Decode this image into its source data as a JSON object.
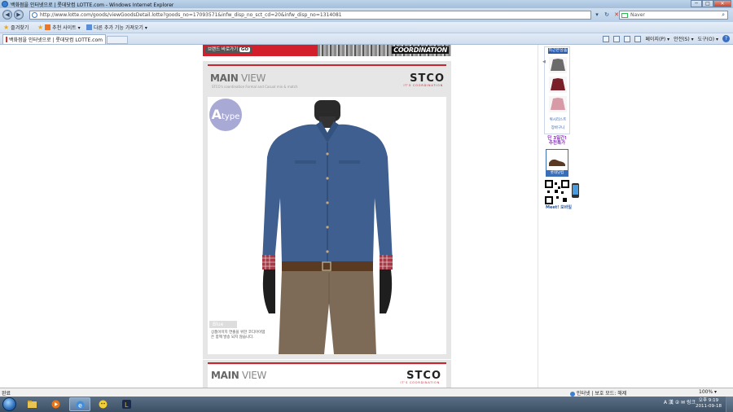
{
  "window": {
    "title": "백화점을 인터넷으로 | 롯데닷컴 LOTTE.com - Windows Internet Explorer",
    "minimize": "─",
    "maximize": "□",
    "close": "✕"
  },
  "address_bar": {
    "url": "http://www.lotte.com/goods/viewGoodsDetail.lotte?goods_no=17093571&infw_disp_no_sct_cd=20&infw_disp_no=1314081",
    "refresh_icon": "refresh-icon",
    "stop_icon": "stop-icon"
  },
  "search": {
    "provider": "Naver",
    "placeholder": "Naver"
  },
  "favorites_bar": {
    "favorites_label": "즐겨찾기",
    "suggested_sites": "추천 사이트 ▾",
    "more_addons": "다른 추가 기능 가져오기 ▾"
  },
  "tab": {
    "label": "백화점을 인터넷으로 | 롯데닷컴 LOTTE.com"
  },
  "command_bar": {
    "page": "페이지(P) ▾",
    "safety": "안전(S) ▾",
    "tools": "도구(O) ▾",
    "help": "?"
  },
  "banner": {
    "go_button": "브랜드 바로가기",
    "go": "GO",
    "logo_text": "COORDINATION"
  },
  "product_card": {
    "main_view": "MAIN",
    "main_view_light": " VIEW",
    "subtitle": "STCO's coordination Formal and Casual mix & match",
    "brand": "STCO",
    "brand_tagline": "IT'S COORDINATION",
    "type_badge_letter": "A",
    "type_badge_word": "type",
    "color_tag": "Blue",
    "caption": "상품이미지 연출을 위한 코디아이템은 함께 발송 되지 않습니다."
  },
  "product_card_2": {
    "main_view": "MAIN",
    "main_view_light": " VIEW",
    "brand": "STCO",
    "brand_tagline": "IT'S COORDINATION"
  },
  "quick_panel": {
    "header": "최근본상품",
    "items": [
      {
        "label": ""
      },
      {
        "label": ""
      },
      {
        "label": "위시리스트"
      },
      {
        "label": "장바구니"
      }
    ],
    "promo_line1": "단 3일간!",
    "promo_line2": "추천특가",
    "shoe_label": "롯데닷컴",
    "meet_label": "Meet! 모바일"
  },
  "status_bar": {
    "done": "완료",
    "zone": "인터넷 | 보호 모드: 해제",
    "zoom": "100% ▾"
  },
  "taskbar": {
    "tray_text": "A 漢 ② ✉  링크",
    "time": "오후 9:19",
    "date": "2011-09-18"
  },
  "colors": {
    "lotte_red": "#d21f2b",
    "shirt_blue": "#3e5f8f",
    "ie_blue": "#3b7fd0",
    "taskbar": "#3c4f64"
  }
}
